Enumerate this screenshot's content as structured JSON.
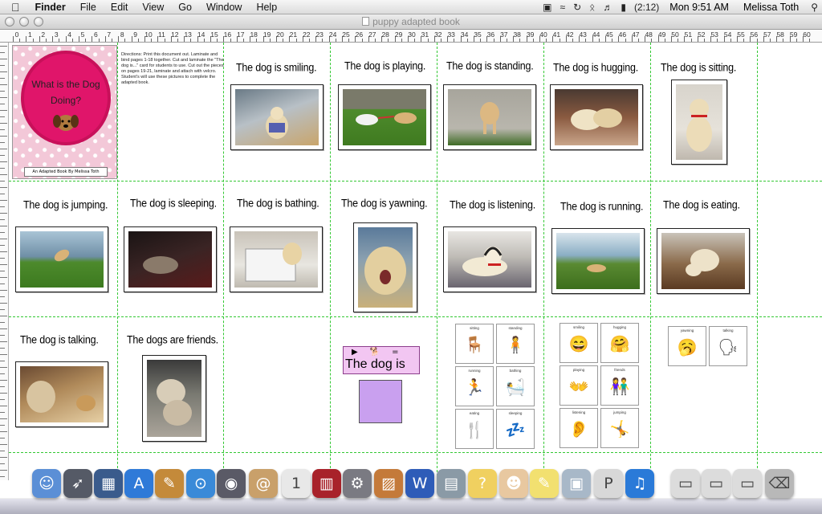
{
  "menubar": {
    "app_name": "Finder",
    "items": [
      "File",
      "Edit",
      "View",
      "Go",
      "Window",
      "Help"
    ],
    "battery": "(2:12)",
    "clock": "Mon 9:51 AM",
    "user": "Melissa Toth",
    "icons": [
      "apple-icon",
      "camera-icon",
      "wifi-icon",
      "time-machine-icon",
      "bluetooth-icon",
      "volume-icon",
      "battery-icon",
      "spotlight-icon"
    ]
  },
  "window": {
    "title": "puppy adapted book"
  },
  "ruler": {
    "numbers": [
      "0",
      "1",
      "2",
      "3",
      "4",
      "5",
      "6",
      "7",
      "8",
      "9",
      "10",
      "11",
      "12",
      "13",
      "14",
      "15",
      "16",
      "17",
      "18",
      "19",
      "20",
      "21",
      "22",
      "23",
      "24",
      "25",
      "26",
      "27",
      "28",
      "29",
      "30",
      "31",
      "32",
      "33",
      "34",
      "35",
      "36",
      "37",
      "38",
      "39",
      "40",
      "41",
      "42",
      "43",
      "44",
      "45",
      "46",
      "47",
      "48",
      "49",
      "50",
      "51",
      "52",
      "53",
      "54",
      "55",
      "56",
      "57",
      "58",
      "59",
      "60"
    ]
  },
  "cover": {
    "title": "What is the Dog Doing?",
    "credit": "An Adapted Book By Melissa Toth"
  },
  "directions": "Directions: Print this document out. Laminate and bind pages 1-18 together. Cut and laminate the \"The dog is...\" card for students to use. Cut out the pieces on pages 19-21, laminate and attach with velcro. Student's will use these pictures to complete the adapted book.",
  "captions": {
    "smiling": "The dog is smiling.",
    "playing": "The dog is playing.",
    "standing": "The dog is standing.",
    "hugging": "The dog is hugging.",
    "sitting": "The dog is sitting.",
    "jumping": "The dog is jumping.",
    "sleeping": "The dog is sleeping.",
    "bathing": "The dog is bathing.",
    "yawning": "The dog is yawning.",
    "listening": "The dog is listening.",
    "running": "The dog is running.",
    "eating": "The dog is eating.",
    "talking": "The dog is talking.",
    "friends": "The dogs are friends."
  },
  "sentence_strip": {
    "text": "The dog is"
  },
  "symbols": {
    "set1": [
      "sitting",
      "standing",
      "running",
      "bathing",
      "eating",
      "sleeping"
    ],
    "set2": [
      "smiling",
      "hugging",
      "playing",
      "friends",
      "listening",
      "jumping"
    ],
    "set3": [
      "yawning",
      "talking"
    ]
  },
  "dock": {
    "apps": [
      "Finder",
      "Launchpad",
      "Mission Control",
      "App Store",
      "Preview",
      "Safari",
      "Photo Booth",
      "Address Book",
      "iCal",
      "Photo Booth Curtain",
      "System Preferences",
      "iPhoto",
      "Word",
      "Scanner",
      "Idea",
      "Boardmaker",
      "Stickies",
      "Photos",
      "Pages",
      "iTunes",
      "Folder",
      "Folder",
      "Folder",
      "Trash"
    ]
  },
  "colors": {
    "guides": "#34c834",
    "cover_pink": "#e0156a",
    "strip_pink": "#f2c6f2",
    "strip_box": "#c9a0ef"
  }
}
